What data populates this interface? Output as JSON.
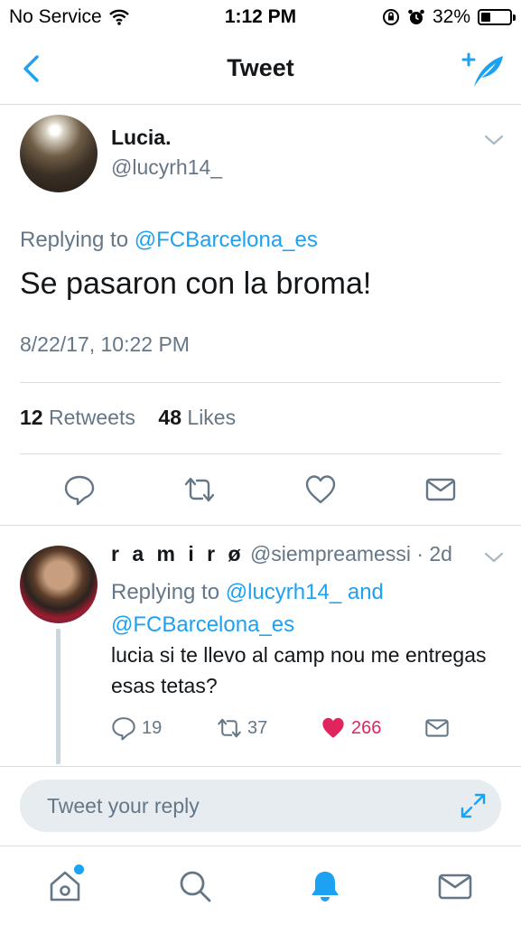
{
  "status_bar": {
    "carrier": "No Service",
    "time": "1:12 PM",
    "battery": "32%",
    "battery_level": 0.32
  },
  "nav": {
    "title": "Tweet",
    "back_icon": "chevron-left-icon",
    "compose_icon": "compose-tweet-icon"
  },
  "tweet": {
    "name": "Lucia.",
    "handle": "@lucyrh14_",
    "replying_prefix": "Replying to ",
    "replying_to": "@FCBarcelona_es",
    "text": "Se pasaron con la broma!",
    "timestamp": "8/22/17, 10:22 PM",
    "retweets_count": "12",
    "retweets_label": "Retweets",
    "likes_count": "48",
    "likes_label": "Likes"
  },
  "reply": {
    "name": "r a m i r ø",
    "handle_time": "@siempreamessi · 2d",
    "replying_prefix": "Replying to ",
    "replying_to_1": "@lucyrh14_",
    "replying_and": " and",
    "replying_to_2": "@FCBarcelona_es",
    "text": "lucia si te llevo al camp nou me entregas esas tetas?",
    "replies": "19",
    "retweets": "37",
    "likes": "266"
  },
  "reply_bar": {
    "placeholder": "Tweet your reply"
  },
  "colors": {
    "accent": "#1da1f2",
    "like": "#e0245e",
    "muted": "#657786"
  }
}
